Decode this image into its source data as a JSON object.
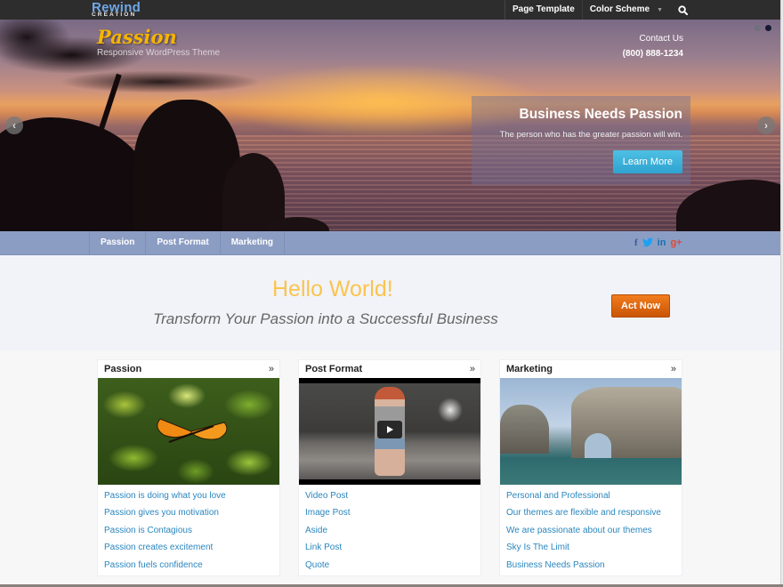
{
  "topbar": {
    "logo_line1": "Rewind",
    "logo_line2": "CREATION",
    "nav": [
      {
        "label": "Page Template"
      },
      {
        "label": "Color Scheme",
        "has_dropdown": true
      }
    ],
    "search_icon": "search-icon",
    "colors": {
      "background": "#2d2d2d",
      "logo": "#6fa8e8"
    }
  },
  "hero": {
    "site_title": "Passion",
    "tagline": "Responsive WordPress Theme",
    "contact_label": "Contact Us",
    "phone": "(800) 888-1234",
    "slide_count": 2,
    "active_slide": 2,
    "prev_icon": "chevron-left-icon",
    "next_icon": "chevron-right-icon",
    "caption": {
      "title": "Business Needs Passion",
      "text": "The person who has the greater passion will win.",
      "button_label": "Learn More"
    },
    "colors": {
      "title": "#f7b500",
      "button": "#35aad6"
    }
  },
  "navbar": {
    "items": [
      {
        "label": "Passion"
      },
      {
        "label": "Post Format"
      },
      {
        "label": "Marketing"
      }
    ],
    "social": [
      {
        "name": "facebook-icon",
        "glyph": "f"
      },
      {
        "name": "twitter-icon",
        "glyph": "🐦"
      },
      {
        "name": "linkedin-icon",
        "glyph": "in"
      },
      {
        "name": "google-plus-icon",
        "glyph": "g+"
      }
    ],
    "colors": {
      "background": "#8c9dc3"
    }
  },
  "cta": {
    "heading": "Hello World!",
    "subheading": "Transform Your Passion into a Successful Business",
    "button_label": "Act Now",
    "colors": {
      "heading": "#fac44e",
      "button": "#e06a10"
    }
  },
  "boxes": [
    {
      "title": "Passion",
      "more_glyph": "»",
      "image": "butterfly-on-leaves",
      "links": [
        "Passion is doing what you love",
        "Passion gives you motivation",
        "Passion is Contagious",
        "Passion creates excitement",
        "Passion fuels confidence"
      ]
    },
    {
      "title": "Post Format",
      "more_glyph": "»",
      "image": "video-thumbnail",
      "links": [
        "Video Post",
        "Image Post",
        "Aside",
        "Link Post",
        "Quote"
      ]
    },
    {
      "title": "Marketing",
      "more_glyph": "»",
      "image": "sea-arch-rocks",
      "links": [
        "Personal and Professional",
        "Our themes are flexible and responsive",
        "We are passionate about our themes",
        "Sky Is The Limit",
        "Business Needs Passion"
      ]
    }
  ],
  "link_color": "#2a86be"
}
